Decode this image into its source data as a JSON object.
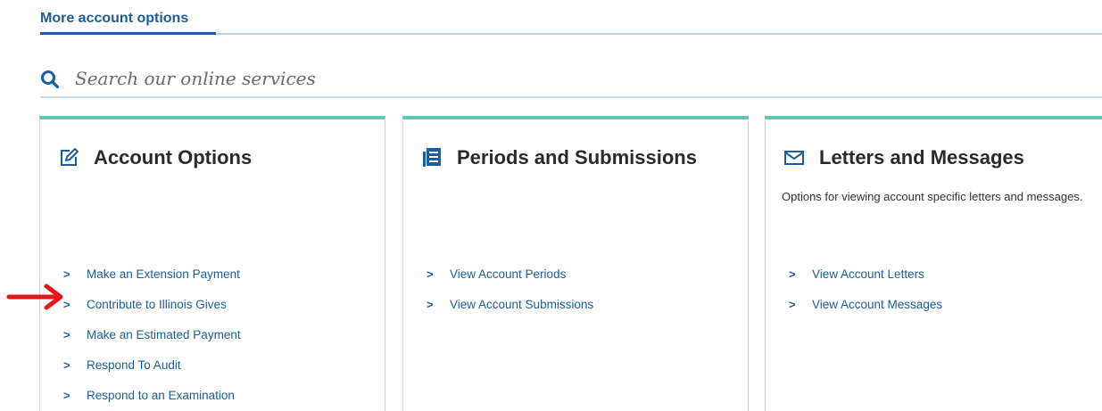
{
  "tab": {
    "label": "More account options"
  },
  "search": {
    "placeholder": "Search our online services",
    "value": ""
  },
  "colors": {
    "accent": "#1b5e9e",
    "card_top_border": "#5fc3c0",
    "annotation_arrow": "#e3161b"
  },
  "cards": [
    {
      "title": "Account Options",
      "icon": "edit-icon",
      "description": "",
      "links": [
        "Make an Extension Payment",
        "Contribute to Illinois Gives",
        "Make an Estimated Payment",
        "Respond To Audit",
        "Respond to an Examination"
      ]
    },
    {
      "title": "Periods and Submissions",
      "icon": "list-icon",
      "description": "",
      "links": [
        "View Account Periods",
        "View Account Submissions"
      ]
    },
    {
      "title": "Letters and Messages",
      "icon": "envelope-icon",
      "description": "Options for viewing account specific letters and messages.",
      "links": [
        "View Account Letters",
        "View Account Messages"
      ]
    }
  ],
  "annotation": {
    "icon": "red-arrow-icon",
    "points_to": "Contribute to Illinois Gives"
  }
}
